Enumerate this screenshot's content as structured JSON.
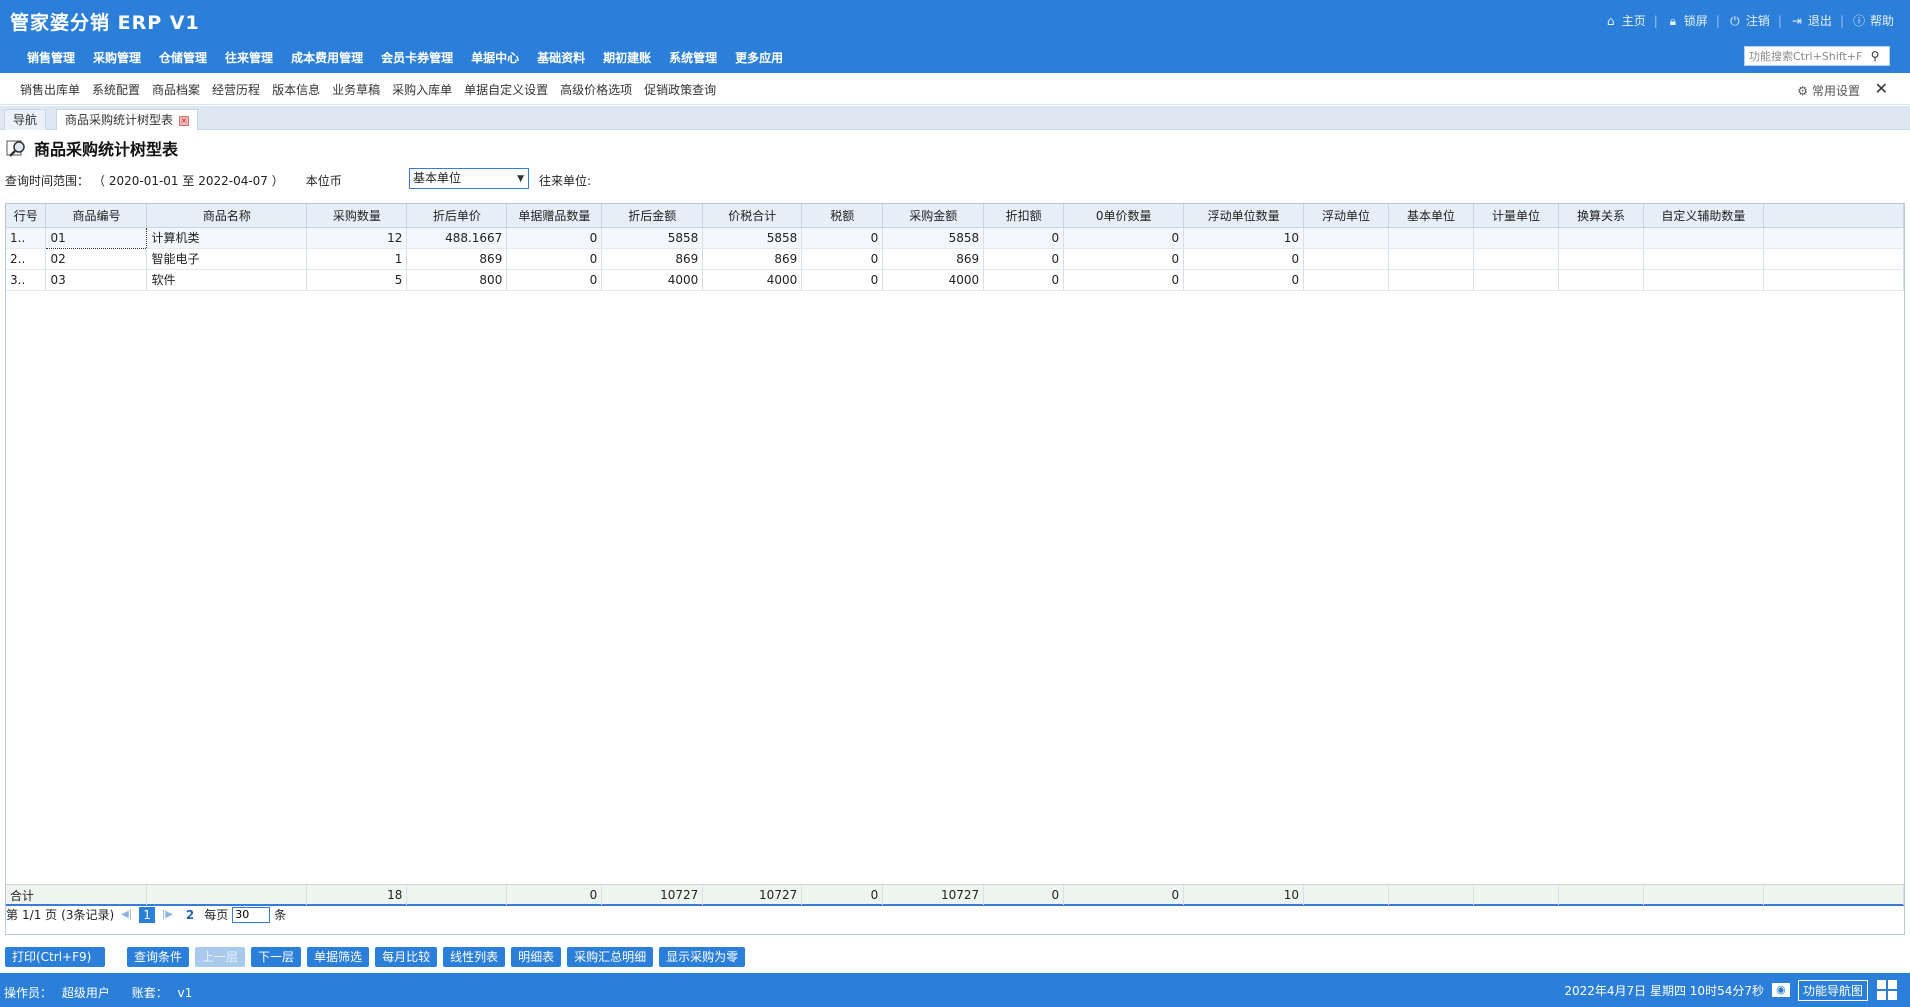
{
  "app": {
    "title": "管家婆分销 ERP V1"
  },
  "top_links": [
    {
      "icon": "home-icon",
      "label": "主页"
    },
    {
      "icon": "lock-icon",
      "label": "锁屏"
    },
    {
      "icon": "logout-circle-icon",
      "label": "注销"
    },
    {
      "icon": "exit-door-icon",
      "label": "退出"
    },
    {
      "icon": "info-icon",
      "label": "帮助"
    }
  ],
  "main_menu": [
    "销售管理",
    "采购管理",
    "仓储管理",
    "往来管理",
    "成本费用管理",
    "会员卡券管理",
    "单据中心",
    "基础资料",
    "期初建账",
    "系统管理",
    "更多应用"
  ],
  "search": {
    "placeholder": "功能搜索Ctrl+Shift+F"
  },
  "quick_items": [
    "销售出库单",
    "系统配置",
    "商品档案",
    "经营历程",
    "版本信息",
    "业务草稿",
    "采购入库单",
    "单据自定义设置",
    "高级价格选项",
    "促销政策查询"
  ],
  "quick_settings": {
    "label": "常用设置"
  },
  "tabs": [
    {
      "label": "导航"
    },
    {
      "label": "商品采购统计树型表"
    }
  ],
  "page": {
    "title": "商品采购统计树型表"
  },
  "filters": {
    "range_label": "查询时间范围：",
    "range_value": "（ 2020-01-01 至 2022-04-07 ）",
    "currency": "本位币",
    "unit_selected": "基本单位",
    "partner_label": "往来单位:"
  },
  "columns": [
    "行号",
    "商品编号",
    "商品名称",
    "采购数量",
    "折后单价",
    "单据赠品数量",
    "折后金额",
    "价税合计",
    "税额",
    "采购金额",
    "折扣额",
    "0单价数量",
    "浮动单位数量",
    "浮动单位",
    "基本单位",
    "计量单位",
    "换算关系",
    "自定义辅助数量"
  ],
  "rows": [
    [
      "1..",
      "01",
      "计算机类",
      "12",
      "488.1667",
      "0",
      "5858",
      "5858",
      "0",
      "5858",
      "0",
      "0",
      "10",
      "",
      "",
      "",
      "",
      ""
    ],
    [
      "2..",
      "02",
      "智能电子",
      "1",
      "869",
      "0",
      "869",
      "869",
      "0",
      "869",
      "0",
      "0",
      "0",
      "",
      "",
      "",
      "",
      ""
    ],
    [
      "3..",
      "03",
      "软件",
      "5",
      "800",
      "0",
      "4000",
      "4000",
      "0",
      "4000",
      "0",
      "0",
      "0",
      "",
      "",
      "",
      "",
      ""
    ]
  ],
  "totals": [
    "合计",
    "",
    "",
    "18",
    "",
    "0",
    "10727",
    "10727",
    "0",
    "10727",
    "0",
    "0",
    "10",
    "",
    "",
    "",
    "",
    ""
  ],
  "pager": {
    "prefix": "第",
    "page_info": "1/1 页",
    "records": "(3条记录)",
    "current": "1",
    "next_page": "2",
    "per_page_label": "每页",
    "per_page_value": "30",
    "suffix": "条"
  },
  "actions": [
    {
      "label": "打印(Ctrl+F9)",
      "disabled": false
    },
    {
      "label": "查询条件",
      "disabled": false
    },
    {
      "label": "上一层",
      "disabled": true
    },
    {
      "label": "下一层",
      "disabled": false
    },
    {
      "label": "单据筛选",
      "disabled": false
    },
    {
      "label": "每月比较",
      "disabled": false
    },
    {
      "label": "线性列表",
      "disabled": false
    },
    {
      "label": "明细表",
      "disabled": false
    },
    {
      "label": "采购汇总明细",
      "disabled": false
    },
    {
      "label": "显示采购为零",
      "disabled": false
    }
  ],
  "status": {
    "operator_label": "操作员：",
    "operator": "超级用户",
    "account_label": "账套：",
    "account": "v1",
    "datetime": "2022年4月7日  星期四  10时54分7秒",
    "nav_button": "功能导航图"
  },
  "colors": {
    "primary": "#2b7fd9",
    "header_bg": "#e6eef7",
    "tab_strip": "#dde8f3"
  }
}
